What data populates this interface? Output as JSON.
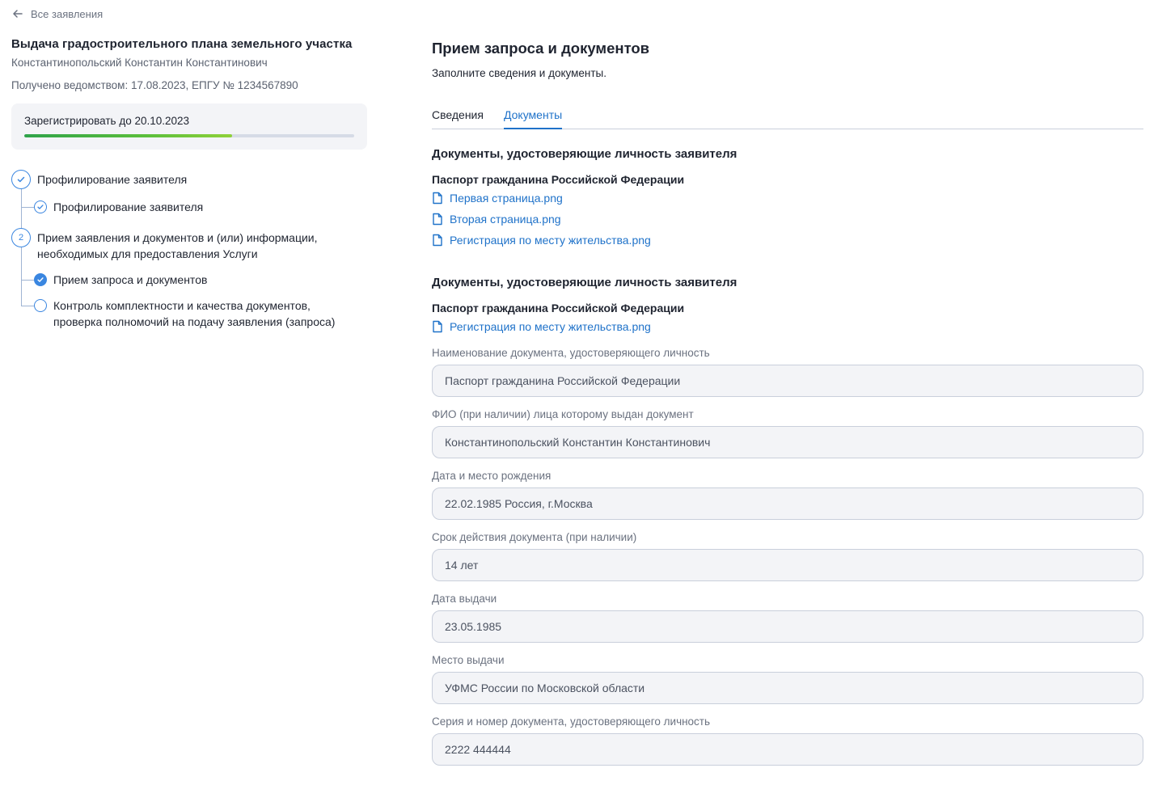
{
  "nav": {
    "back_label": "Все заявления"
  },
  "case": {
    "title": "Выдача градостроительного плана земельного участка",
    "applicant": "Константинопольский Константин Константинович",
    "received": "Получено ведомством: 17.08.2023, ЕПГУ № 1234567890"
  },
  "deadline": {
    "label": "Зарегистрировать до 20.10.2023",
    "progress": 0.63
  },
  "steps": [
    {
      "label": "Профилирование заявителя",
      "state": "done",
      "number": ""
    },
    {
      "label": "Профилирование заявителя",
      "state": "done",
      "sub": true
    },
    {
      "label_line1": "Прием заявления и документов и (или) информации,",
      "label_line2": "необходимых для предоставления Услуги",
      "state": "active",
      "number": "2"
    },
    {
      "label": "Прием запроса и документов",
      "state": "current",
      "sub": true
    },
    {
      "label_line1": "Контроль комплектности и качества документов,",
      "label_line2": "проверка полномочий на подачу заявления (запроса)",
      "state": "pending",
      "sub": true
    }
  ],
  "main": {
    "title": "Прием запроса и документов",
    "subtitle": "Заполните сведения и документы.",
    "tabs": [
      {
        "label": "Сведения",
        "active": false
      },
      {
        "label": "Документы",
        "active": true
      }
    ]
  },
  "sections": [
    {
      "title": "Документы, удостоверяющие личность заявителя",
      "doc_title": "Паспорт гражданина Российской Федерации",
      "files": [
        "Первая страница.png",
        "Вторая страница.png",
        "Регистрация по месту жительства.png"
      ]
    },
    {
      "title": "Документы, удостоверяющие личность заявителя",
      "doc_title": "Паспорт гражданина Российской Федерации",
      "files": [
        "Регистрация по месту жительства.png"
      ]
    }
  ],
  "fields": [
    {
      "label": "Наименование документа, удостоверяющего личность",
      "value": "Паспорт гражданина Российской Федерации"
    },
    {
      "label": "ФИО (при наличии) лица которому выдан документ",
      "value": "Константинопольский Константин Константинович"
    },
    {
      "label": "Дата и место рождения",
      "value": "22.02.1985 Россия, г.Москва"
    },
    {
      "label": "Срок действия документа (при наличии)",
      "value": "14 лет"
    },
    {
      "label": "Дата выдачи",
      "value": "23.05.1985"
    },
    {
      "label": "Место выдачи",
      "value": "УФМС России по Московской области"
    },
    {
      "label": "Серия и номер документа, удостоверяющего личность",
      "value": "2222 444444"
    }
  ],
  "colors": {
    "accent": "#1f72c9",
    "step_blue": "#3a86e0",
    "progress_green": "#2fa34a"
  }
}
